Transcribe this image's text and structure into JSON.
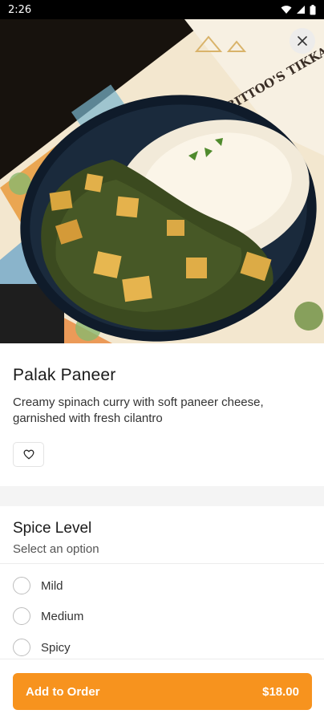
{
  "status_bar": {
    "time": "2:26",
    "icons": [
      "wifi-icon",
      "signal-icon",
      "battery-icon"
    ]
  },
  "hero": {
    "image": "palak-paneer-photo",
    "brand_text": "BITTOO'S TIKKA",
    "close_icon": "close-icon"
  },
  "dish": {
    "name": "Palak Paneer",
    "description": "Creamy spinach curry with soft paneer cheese, garnished with fresh cilantro",
    "favorite_icon": "heart-outline-icon"
  },
  "options": {
    "title": "Spice Level",
    "subtitle": "Select an option",
    "choices": [
      {
        "label": "Mild",
        "selected": false
      },
      {
        "label": "Medium",
        "selected": false
      },
      {
        "label": "Spicy",
        "selected": false
      }
    ]
  },
  "footer": {
    "button_label": "Add to Order",
    "price": "$18.00"
  },
  "colors": {
    "accent": "#f7931e",
    "text_primary": "#1a1a1a",
    "separator": "#f4f4f4"
  }
}
